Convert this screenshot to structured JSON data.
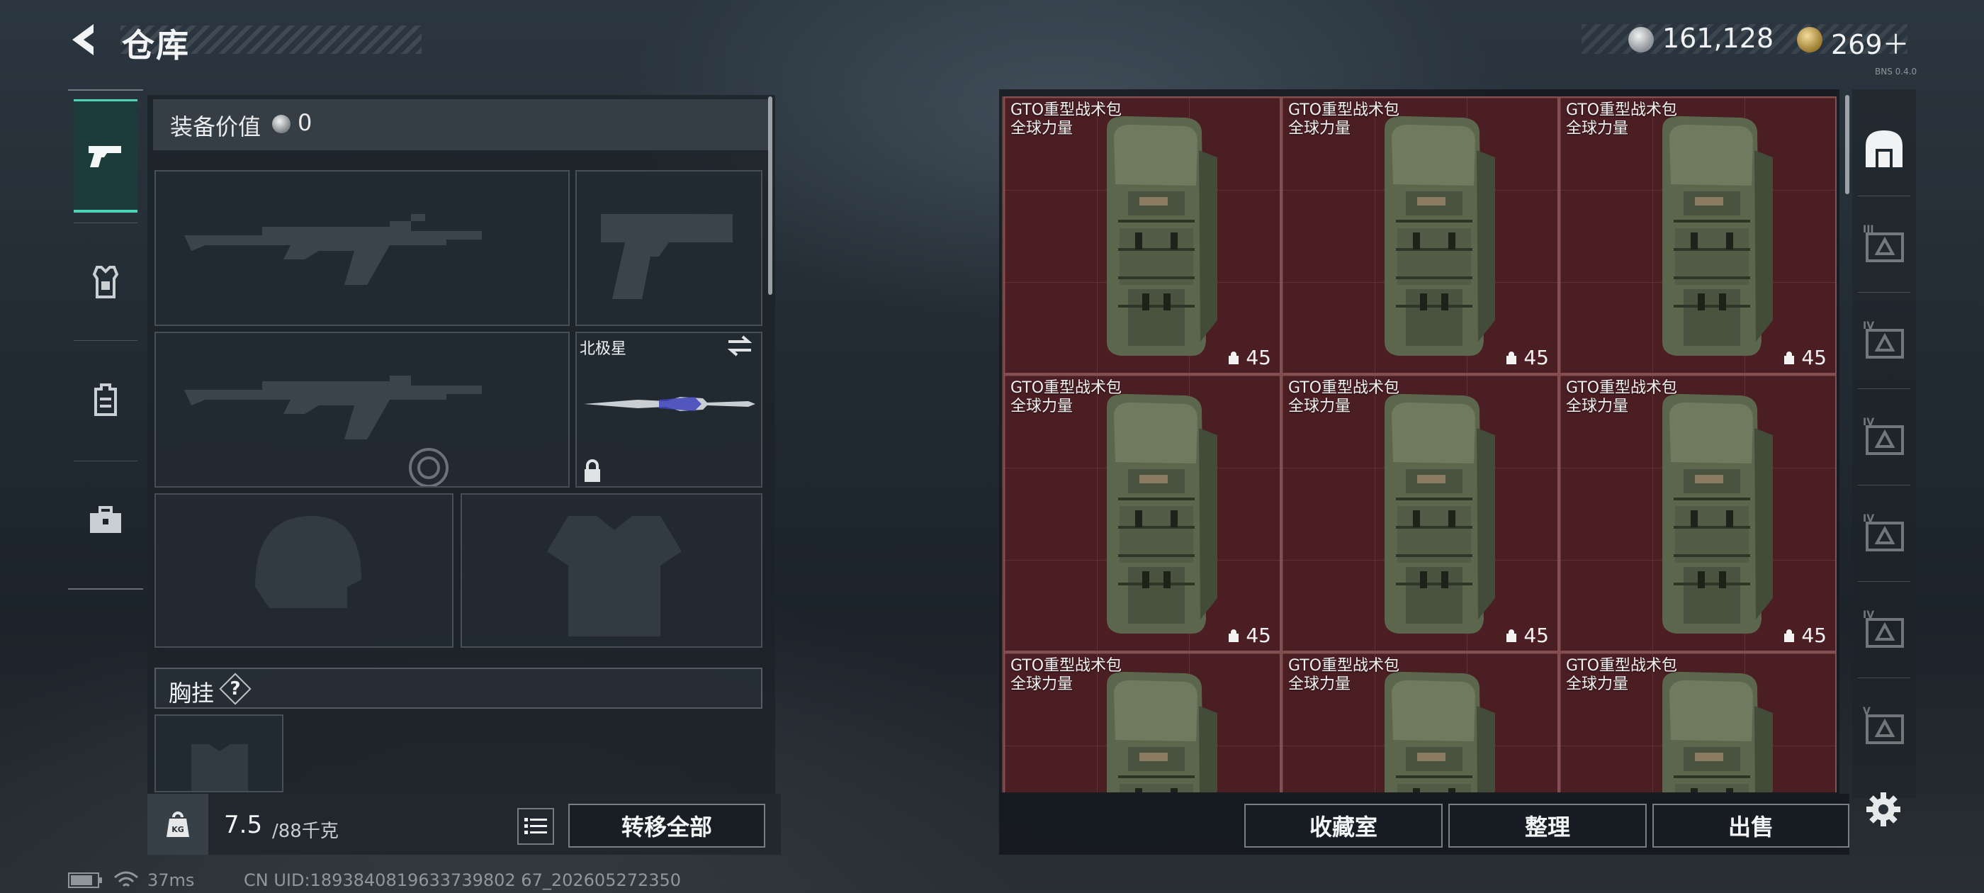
{
  "header": {
    "title": "仓库",
    "currencies": [
      {
        "icon": "silver-coin-icon",
        "amount": "161,128"
      },
      {
        "icon": "gold-coin-icon",
        "amount": "269＋"
      }
    ],
    "version": "BNS 0.4.0"
  },
  "left_sidebar": {
    "tabs": [
      {
        "icon": "pistol-icon",
        "active": true
      },
      {
        "icon": "armor-vest-icon",
        "active": false
      },
      {
        "icon": "backpack-icon",
        "active": false
      },
      {
        "icon": "briefcase-icon",
        "active": false
      }
    ]
  },
  "equipment": {
    "value_label": "装备价值",
    "value": "0",
    "melee_name": "北极星",
    "chest_rig_label": "胸挂",
    "chest_rig_help": "?"
  },
  "weight": {
    "current": "7.5",
    "max": "/88千克"
  },
  "buttons": {
    "transfer_all": "转移全部",
    "collection": "收藏室",
    "sort": "整理",
    "sell": "出售"
  },
  "grid": {
    "items": [
      {
        "name": "GTO重型战术包",
        "sub": "全球力量",
        "qty": "45"
      },
      {
        "name": "GTO重型战术包",
        "sub": "全球力量",
        "qty": "45"
      },
      {
        "name": "GTO重型战术包",
        "sub": "全球力量",
        "qty": "45"
      },
      {
        "name": "GTO重型战术包",
        "sub": "全球力量",
        "qty": "45"
      },
      {
        "name": "GTO重型战术包",
        "sub": "全球力量",
        "qty": "45"
      },
      {
        "name": "GTO重型战术包",
        "sub": "全球力量",
        "qty": "45"
      },
      {
        "name": "GTO重型战术包",
        "sub": "全球力量",
        "qty": ""
      },
      {
        "name": "GTO重型战术包",
        "sub": "全球力量",
        "qty": ""
      },
      {
        "name": "GTO重型战术包",
        "sub": "全球力量",
        "qty": ""
      }
    ]
  },
  "right_sidebar": {
    "tabs": [
      {
        "icon": "warehouse-icon",
        "tier": ""
      },
      {
        "icon": "storage-tier-3-icon",
        "tier": "III"
      },
      {
        "icon": "storage-tier-4a-icon",
        "tier": "IV"
      },
      {
        "icon": "storage-tier-4b-icon",
        "tier": "IV"
      },
      {
        "icon": "storage-tier-4c-icon",
        "tier": "IV"
      },
      {
        "icon": "storage-tier-4d-icon",
        "tier": "IV"
      },
      {
        "icon": "storage-tier-5-icon",
        "tier": "V"
      }
    ]
  },
  "status": {
    "ping": "37ms",
    "uid": "CN UID:1893840819633739802 67_202605272350"
  }
}
